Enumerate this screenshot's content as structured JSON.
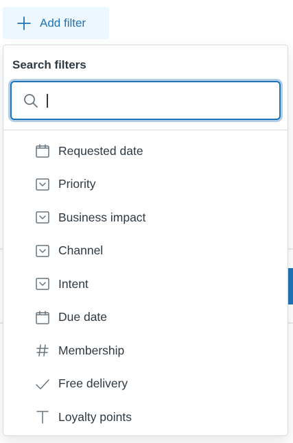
{
  "add_filter": {
    "label": "Add filter",
    "icon": "plus-icon"
  },
  "dropdown": {
    "search_label": "Search filters",
    "search_value": "",
    "search_placeholder": "",
    "options": [
      {
        "label": "Requested date",
        "icon": "calendar-icon"
      },
      {
        "label": "Priority",
        "icon": "dropdown-field-icon"
      },
      {
        "label": "Business impact",
        "icon": "dropdown-field-icon"
      },
      {
        "label": "Channel",
        "icon": "dropdown-field-icon"
      },
      {
        "label": "Intent",
        "icon": "dropdown-field-icon"
      },
      {
        "label": "Due date",
        "icon": "calendar-icon"
      },
      {
        "label": "Membership",
        "icon": "hash-icon"
      },
      {
        "label": "Free delivery",
        "icon": "checkmark-icon"
      },
      {
        "label": "Loyalty points",
        "icon": "text-field-icon"
      }
    ]
  },
  "colors": {
    "accent": "#1f73b7",
    "button_bg": "#edf7ff",
    "text": "#2f3941",
    "icon": "#68737d",
    "border": "#d8dcde"
  }
}
